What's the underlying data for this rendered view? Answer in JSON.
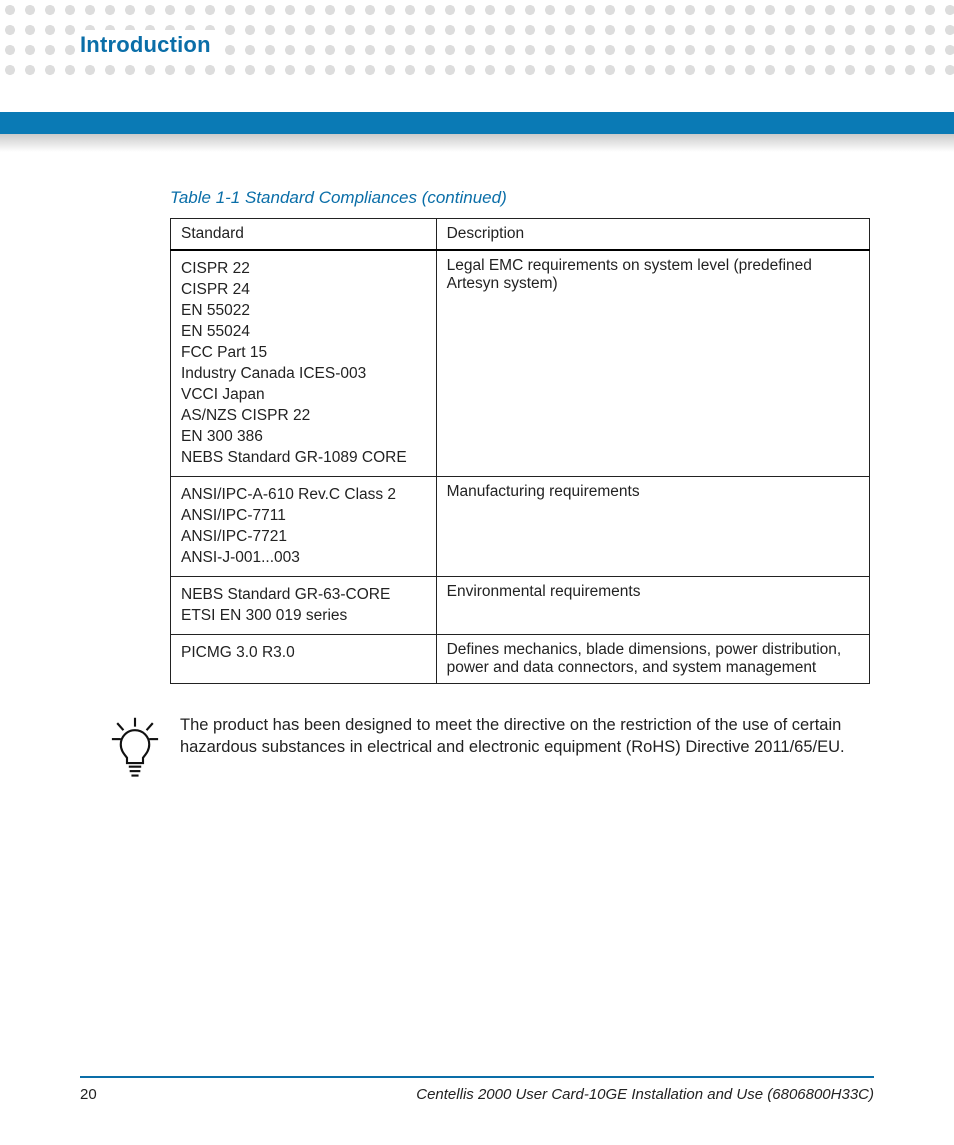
{
  "header": {
    "section_title": "Introduction"
  },
  "table": {
    "caption": "Table 1-1 Standard Compliances (continued)",
    "columns": [
      "Standard",
      "Description"
    ],
    "rows": [
      {
        "standards": [
          "CISPR 22",
          "CISPR 24",
          "EN 55022",
          "EN 55024",
          "FCC Part 15",
          "Industry Canada ICES-003",
          "VCCI Japan",
          "AS/NZS CISPR 22",
          "EN 300 386",
          "NEBS Standard GR-1089 CORE"
        ],
        "description": "Legal EMC requirements on system level (predefined Artesyn system)"
      },
      {
        "standards": [
          "ANSI/IPC-A-610 Rev.C Class 2",
          "ANSI/IPC-7711",
          "ANSI/IPC-7721",
          "ANSI-J-001...003"
        ],
        "description": "Manufacturing requirements"
      },
      {
        "standards": [
          "NEBS Standard GR-63-CORE",
          "ETSI EN 300 019 series"
        ],
        "description": "Environmental requirements"
      },
      {
        "standards": [
          "PICMG 3.0 R3.0"
        ],
        "description": "Defines mechanics, blade dimensions, power distribution, power and data connectors, and system management"
      }
    ]
  },
  "note": {
    "text": "The product has been designed to meet the directive on the restriction of the use of certain hazardous substances in electrical and electronic equipment (RoHS) Directive 2011/65/EU."
  },
  "footer": {
    "page_number": "20",
    "doc_title": "Centellis 2000 User Card-10GE Installation and Use (6806800H33C)"
  }
}
